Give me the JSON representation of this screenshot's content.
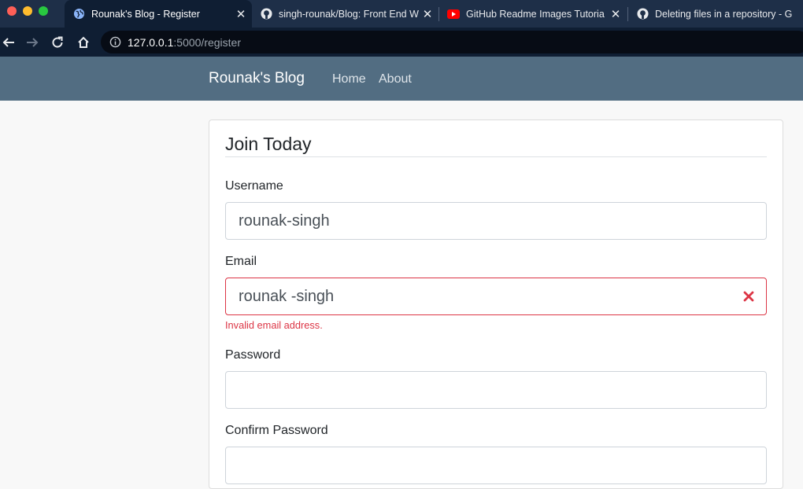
{
  "browser": {
    "tabs": [
      {
        "title": "Rounak's Blog - Register",
        "favicon": "globe-icon",
        "active": true
      },
      {
        "title": "singh-rounak/Blog: Front End W",
        "favicon": "github-icon",
        "active": false
      },
      {
        "title": "GitHub Readme Images Tutoria",
        "favicon": "youtube-icon",
        "active": false
      },
      {
        "title": "Deleting files in a repository - G",
        "favicon": "github-icon",
        "active": false
      }
    ],
    "address": {
      "host": "127.0.0.1",
      "path": ":5000/register"
    }
  },
  "site": {
    "brand": "Rounak's Blog",
    "nav": [
      "Home",
      "About"
    ]
  },
  "form": {
    "legend": "Join Today",
    "username": {
      "label": "Username",
      "value": "rounak-singh"
    },
    "email": {
      "label": "Email",
      "value": "rounak -singh",
      "error": "Invalid email address."
    },
    "password": {
      "label": "Password",
      "value": ""
    },
    "confirm_password": {
      "label": "Confirm Password",
      "value": ""
    }
  },
  "colors": {
    "navbar": "#526d82",
    "error": "#dc3545"
  }
}
